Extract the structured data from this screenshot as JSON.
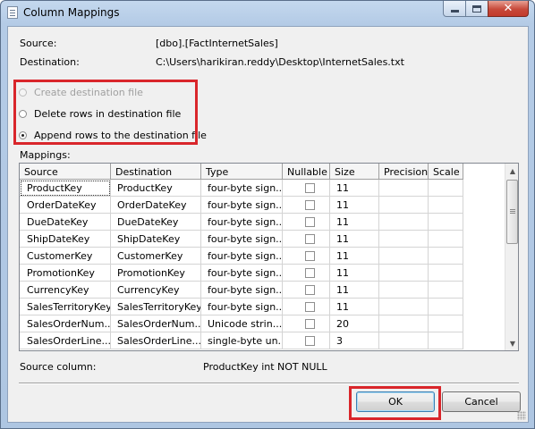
{
  "window": {
    "title": "Column Mappings"
  },
  "source": {
    "label": "Source:",
    "value": "[dbo].[FactInternetSales]"
  },
  "destination": {
    "label": "Destination:",
    "value": "C:\\Users\\harikiran.reddy\\Desktop\\InternetSales.txt"
  },
  "options": [
    {
      "label": "Create destination file",
      "checked": false,
      "enabled": false
    },
    {
      "label": "Delete rows in destination file",
      "checked": false,
      "enabled": true
    },
    {
      "label": "Append rows to the destination file",
      "checked": true,
      "enabled": true
    }
  ],
  "mappings": {
    "label": "Mappings:",
    "columns": [
      "Source",
      "Destination",
      "Type",
      "Nullable",
      "Size",
      "Precision",
      "Scale"
    ],
    "rows": [
      {
        "source": "ProductKey",
        "destination": "ProductKey",
        "type": "four-byte sign...",
        "nullable": false,
        "size": "11",
        "precision": "",
        "scale": ""
      },
      {
        "source": "OrderDateKey",
        "destination": "OrderDateKey",
        "type": "four-byte sign...",
        "nullable": false,
        "size": "11",
        "precision": "",
        "scale": ""
      },
      {
        "source": "DueDateKey",
        "destination": "DueDateKey",
        "type": "four-byte sign...",
        "nullable": false,
        "size": "11",
        "precision": "",
        "scale": ""
      },
      {
        "source": "ShipDateKey",
        "destination": "ShipDateKey",
        "type": "four-byte sign...",
        "nullable": false,
        "size": "11",
        "precision": "",
        "scale": ""
      },
      {
        "source": "CustomerKey",
        "destination": "CustomerKey",
        "type": "four-byte sign...",
        "nullable": false,
        "size": "11",
        "precision": "",
        "scale": ""
      },
      {
        "source": "PromotionKey",
        "destination": "PromotionKey",
        "type": "four-byte sign...",
        "nullable": false,
        "size": "11",
        "precision": "",
        "scale": ""
      },
      {
        "source": "CurrencyKey",
        "destination": "CurrencyKey",
        "type": "four-byte sign...",
        "nullable": false,
        "size": "11",
        "precision": "",
        "scale": ""
      },
      {
        "source": "SalesTerritoryKey",
        "destination": "SalesTerritoryKey",
        "type": "four-byte sign...",
        "nullable": false,
        "size": "11",
        "precision": "",
        "scale": ""
      },
      {
        "source": "SalesOrderNum...",
        "destination": "SalesOrderNum...",
        "type": "Unicode strin...",
        "nullable": false,
        "size": "20",
        "precision": "",
        "scale": ""
      },
      {
        "source": "SalesOrderLine...",
        "destination": "SalesOrderLine...",
        "type": "single-byte un...",
        "nullable": false,
        "size": "3",
        "precision": "",
        "scale": ""
      }
    ]
  },
  "source_column": {
    "label": "Source column:",
    "value": "ProductKey int NOT NULL"
  },
  "buttons": {
    "ok": "OK",
    "cancel": "Cancel"
  },
  "colors": {
    "highlight": "#d9262b",
    "title_bar": "#b4cbe6"
  }
}
